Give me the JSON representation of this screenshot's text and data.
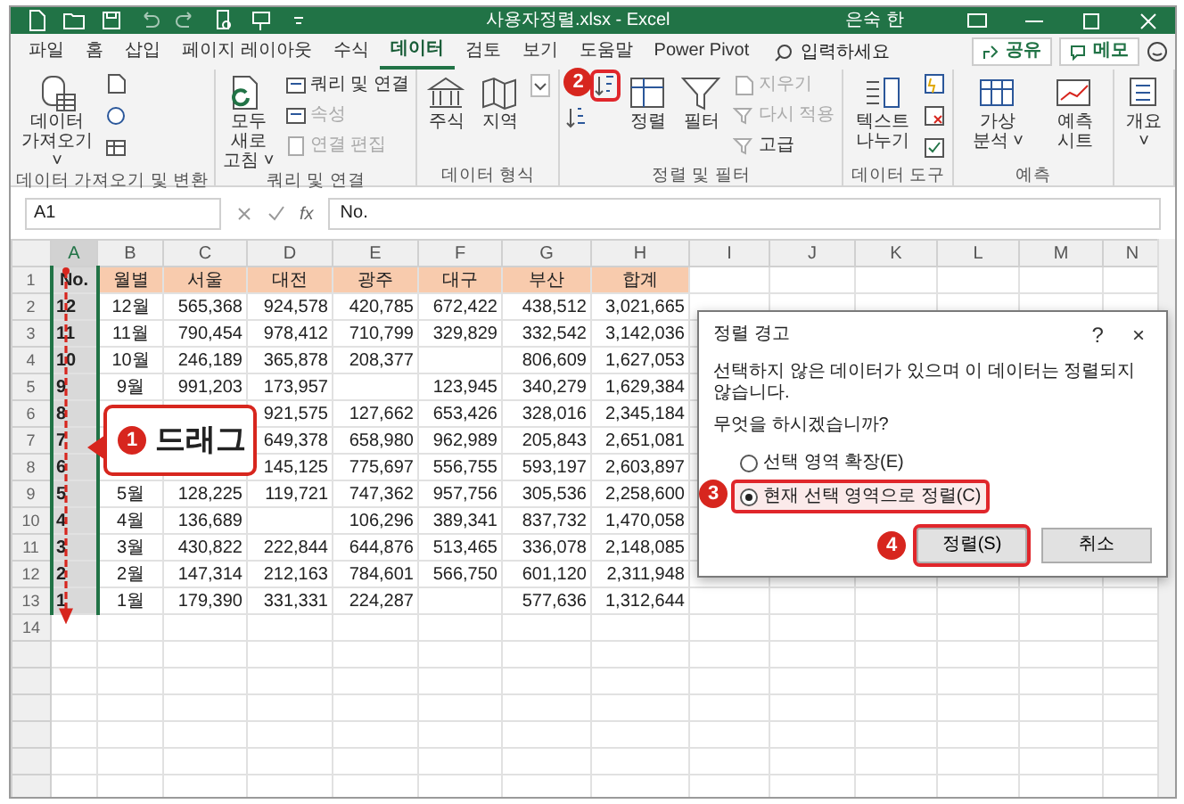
{
  "title_bar": {
    "title": "사용자정렬.xlsx - Excel",
    "user": "은숙 한"
  },
  "menu_tabs": [
    {
      "label": "파일",
      "selected": false
    },
    {
      "label": "홈",
      "selected": false
    },
    {
      "label": "삽입",
      "selected": false
    },
    {
      "label": "페이지 레이아웃",
      "selected": false
    },
    {
      "label": "수식",
      "selected": false
    },
    {
      "label": "데이터",
      "selected": true
    },
    {
      "label": "검토",
      "selected": false
    },
    {
      "label": "보기",
      "selected": false
    },
    {
      "label": "도움말",
      "selected": false
    },
    {
      "label": "Power Pivot",
      "selected": false
    }
  ],
  "search": {
    "placeholder": "입력하세요"
  },
  "share_button": "공유",
  "memo_button": "메모",
  "ribbon_groups": [
    {
      "label": "데이터 가져오기 및 변환",
      "commands": [
        {
          "kind": "large",
          "label": "데이터 가져오기 ˅"
        },
        {
          "kind": "icon"
        },
        {
          "kind": "icon"
        },
        {
          "kind": "icon"
        }
      ]
    },
    {
      "label": "쿼리 및 연결",
      "commands": [
        {
          "kind": "large",
          "label": "모두 새로 고침 ˅"
        },
        {
          "kind": "small",
          "label": "쿼리 및 연결",
          "disabled": false
        },
        {
          "kind": "small",
          "label": "속성",
          "disabled": true
        },
        {
          "kind": "small",
          "label": "연결 편집",
          "disabled": true
        }
      ]
    },
    {
      "label": "데이터 형식",
      "commands": [
        {
          "kind": "large",
          "label": "주식"
        },
        {
          "kind": "large",
          "label": "지역"
        },
        {
          "kind": "icon"
        }
      ]
    },
    {
      "label": "정렬 및 필터",
      "commands": [
        {
          "kind": "icon",
          "highlighted": true,
          "badge": "2"
        },
        {
          "kind": "icon",
          "highlighted": false
        },
        {
          "kind": "large",
          "label": "정렬"
        },
        {
          "kind": "large",
          "label": "필터"
        },
        {
          "kind": "small",
          "label": "지우기",
          "disabled": true
        },
        {
          "kind": "small",
          "label": "다시 적용",
          "disabled": true
        },
        {
          "kind": "small",
          "label": "고급",
          "disabled": false
        }
      ]
    },
    {
      "label": "데이터 도구",
      "commands": [
        {
          "kind": "large",
          "label": "텍스트 나누기"
        },
        {
          "kind": "icon"
        },
        {
          "kind": "icon"
        },
        {
          "kind": "icon"
        }
      ]
    },
    {
      "label": "예측",
      "commands": [
        {
          "kind": "large",
          "label": "가상 분석 ˅"
        },
        {
          "kind": "large",
          "label": "예측 시트"
        }
      ]
    },
    {
      "commands": [
        {
          "kind": "large",
          "label": "개요 ˅"
        }
      ]
    }
  ],
  "name_box": "A1",
  "function_symbol": "fx",
  "formula": "No.",
  "columns": [
    {
      "label": "A",
      "selected": true
    },
    {
      "label": "B",
      "selected": false
    },
    {
      "label": "C",
      "selected": false
    },
    {
      "label": "D",
      "selected": false
    },
    {
      "label": "E",
      "selected": false
    },
    {
      "label": "F",
      "selected": false
    },
    {
      "label": "G",
      "selected": false
    },
    {
      "label": "H",
      "selected": false
    },
    {
      "label": "I",
      "selected": false
    },
    {
      "label": "J",
      "selected": false
    },
    {
      "label": "K",
      "selected": false
    },
    {
      "label": "L",
      "selected": false
    },
    {
      "label": "M",
      "selected": false
    },
    {
      "label": "N",
      "selected": false
    }
  ],
  "rows": [
    {
      "number": "1",
      "kind": "header",
      "cells": [
        "No.",
        "월별",
        "서울",
        "대전",
        "광주",
        "대구",
        "부산",
        "합계"
      ]
    },
    {
      "number": "2",
      "kind": "data",
      "cells": [
        "12",
        "12월",
        "565,368",
        "924,578",
        "420,785",
        "672,422",
        "438,512",
        "3,021,665"
      ]
    },
    {
      "number": "3",
      "kind": "data",
      "cells": [
        "11",
        "11월",
        "790,454",
        "978,412",
        "710,799",
        "329,829",
        "332,542",
        "3,142,036"
      ]
    },
    {
      "number": "4",
      "kind": "data",
      "cells": [
        "10",
        "10월",
        "246,189",
        "365,878",
        "208,377",
        null,
        "806,609",
        "1,627,053"
      ]
    },
    {
      "number": "5",
      "kind": "data",
      "cells": [
        "9",
        "9월",
        "991,203",
        "173,957",
        null,
        "123,945",
        "340,279",
        "1,629,384"
      ]
    },
    {
      "number": "6",
      "kind": "data",
      "cells": [
        "8",
        null,
        null,
        "921,575",
        "127,662",
        "653,426",
        "328,016",
        "2,345,184"
      ]
    },
    {
      "number": "7",
      "kind": "data",
      "cells": [
        "7",
        null,
        null,
        "649,378",
        "658,980",
        "962,989",
        "205,843",
        "2,651,081"
      ]
    },
    {
      "number": "8",
      "kind": "data",
      "cells": [
        "6",
        null,
        null,
        "145,125",
        "775,697",
        "556,755",
        "593,197",
        "2,603,897"
      ]
    },
    {
      "number": "9",
      "kind": "data",
      "cells": [
        "5",
        "5월",
        "128,225",
        "119,721",
        "747,362",
        "957,756",
        "305,536",
        "2,258,600"
      ]
    },
    {
      "number": "10",
      "kind": "data",
      "cells": [
        "4",
        "4월",
        "136,689",
        null,
        "106,296",
        "389,341",
        "837,732",
        "1,470,058"
      ]
    },
    {
      "number": "11",
      "kind": "data",
      "cells": [
        "3",
        "3월",
        "430,822",
        "222,844",
        "644,876",
        "513,465",
        "336,078",
        "2,148,085"
      ]
    },
    {
      "number": "12",
      "kind": "data",
      "cells": [
        "2",
        "2월",
        "147,314",
        "212,163",
        "784,601",
        "566,750",
        "601,120",
        "2,311,948"
      ]
    },
    {
      "number": "13",
      "kind": "data",
      "cells": [
        "1",
        "1월",
        "179,390",
        "331,331",
        "224,287",
        null,
        "577,636",
        "1,312,644"
      ]
    },
    {
      "number": "14",
      "kind": "data",
      "cells": []
    }
  ],
  "callout": {
    "badge": "1",
    "text": "드래그"
  },
  "dialog": {
    "title": "정렬 경고",
    "help": "?",
    "close": "×",
    "message": "선택하지 않은 데이터가 있으며 이 데이터는 정렬되지 않습니다.",
    "question": "무엇을 하시겠습니까?",
    "options": [
      {
        "label": "선택 영역 확장(E)",
        "selected": false,
        "highlighted": false
      },
      {
        "label": "현재 선택 영역으로 정렬(C)",
        "selected": true,
        "highlighted": true,
        "badge": "3"
      }
    ],
    "buttons": [
      {
        "label": "정렬(S)",
        "highlighted": true,
        "badge": "4"
      },
      {
        "label": "취소",
        "highlighted": false
      }
    ]
  }
}
